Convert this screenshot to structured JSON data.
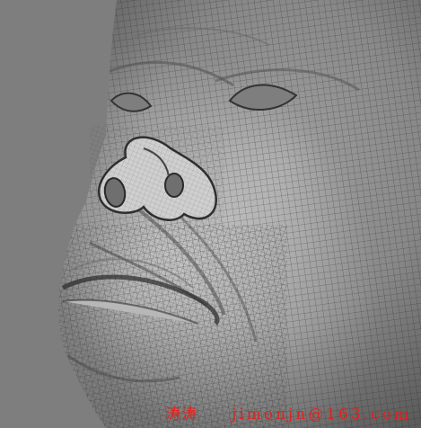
{
  "viewport": {
    "background": "#7e7e7e",
    "subject": "wireframe-sculpted-face",
    "mesh_color": "#3a3a3a",
    "skin_color": "#d9d9d9"
  },
  "watermark": {
    "author": "涛涛",
    "email": "jimonjn@163.com",
    "color": "#e0221c"
  }
}
